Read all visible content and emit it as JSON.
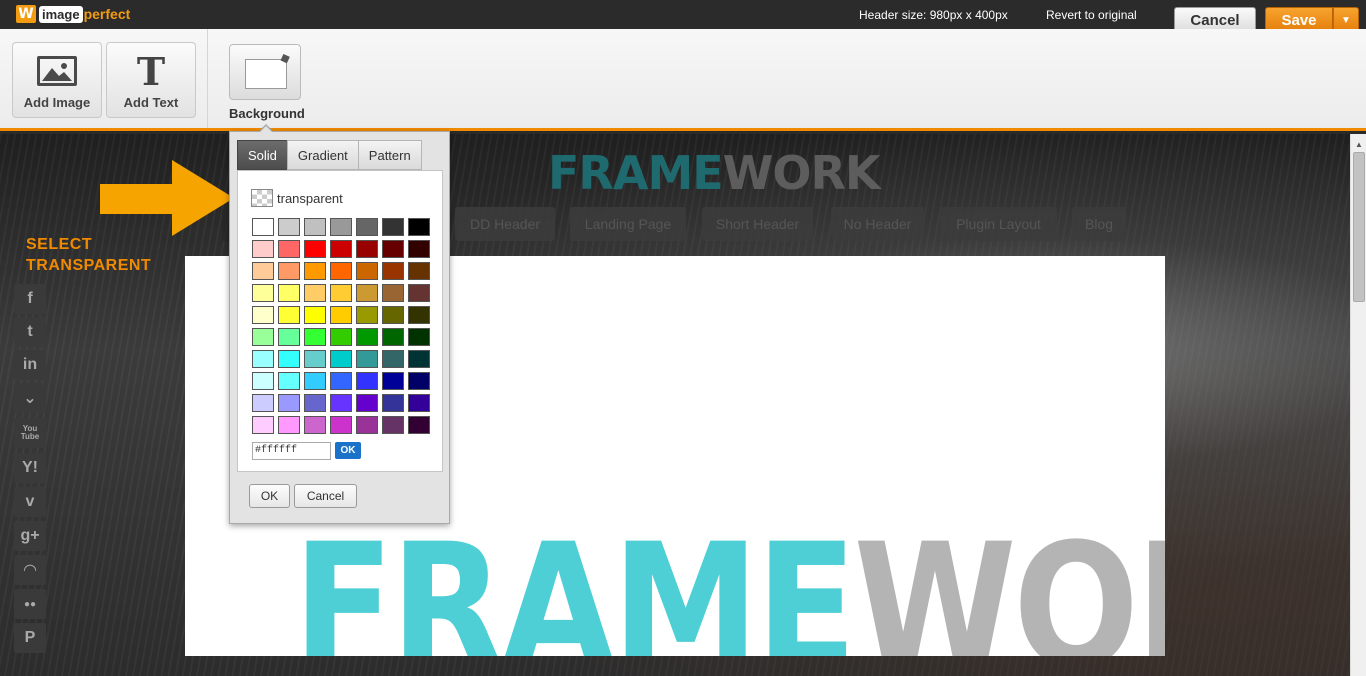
{
  "app": {
    "logo_mark": "W",
    "logo_image": "image",
    "logo_perfect": "perfect"
  },
  "topbar": {
    "header_size": "Header size: 980px x 400px",
    "revert": "Revert to original",
    "cancel": "Cancel",
    "save": "Save",
    "save_caret": "▼"
  },
  "toolbar": {
    "add_image": "Add Image",
    "add_text": "Add Text",
    "add_text_glyph": "T",
    "background": "Background"
  },
  "canvas": {
    "ghost_title_a": "FRAME",
    "ghost_title_b": "WORK",
    "nav": [
      "DD Header",
      "Landing Page",
      "Short Header",
      "No Header",
      "Plugin Layout",
      "Blog"
    ],
    "annotation_line1": "SELECT",
    "annotation_line2": "TRANSPARENT",
    "big_title_a": "FRAME",
    "big_title_b": "WORK",
    "social_icons": [
      "facebook-icon",
      "twitter-icon",
      "linkedin-icon",
      "delicious-icon",
      "youtube-icon",
      "yahoo-icon",
      "vimeo-icon",
      "google-plus-icon",
      "rss-icon",
      "flickr-icon",
      "pinterest-icon"
    ],
    "social_glyphs": [
      "f",
      "t",
      "in",
      "⌄",
      "You Tube",
      "Y!",
      "v",
      "g+",
      "◠",
      "●●",
      "P"
    ]
  },
  "popup": {
    "tabs": [
      "Solid",
      "Gradient",
      "Pattern"
    ],
    "active_tab": "Solid",
    "transparent_label": "transparent",
    "hex_value": "#ffffff",
    "hex_ok": "OK",
    "ok": "OK",
    "cancel": "Cancel",
    "colors": [
      "#ffffff",
      "#cccccc",
      "#c0c0c0",
      "#999999",
      "#666666",
      "#333333",
      "#000000",
      "#ffcccc",
      "#ff6666",
      "#ff0000",
      "#cc0000",
      "#990000",
      "#660000",
      "#330000",
      "#ffcc99",
      "#ff9966",
      "#ff9900",
      "#ff6600",
      "#cc6600",
      "#993300",
      "#663300",
      "#ffff99",
      "#ffff66",
      "#ffcc66",
      "#ffcc33",
      "#cc9933",
      "#996633",
      "#663333",
      "#ffffcc",
      "#ffff33",
      "#ffff00",
      "#ffcc00",
      "#999900",
      "#666600",
      "#333300",
      "#99ff99",
      "#66ff99",
      "#33ff33",
      "#33cc00",
      "#009900",
      "#006600",
      "#003300",
      "#99ffff",
      "#33ffff",
      "#66cccc",
      "#00cccc",
      "#339999",
      "#336666",
      "#003333",
      "#ccffff",
      "#66ffff",
      "#33ccff",
      "#3366ff",
      "#3333ff",
      "#000099",
      "#000066",
      "#ccccff",
      "#9999ff",
      "#6666cc",
      "#6633ff",
      "#6600cc",
      "#333399",
      "#330099",
      "#ffccff",
      "#ff99ff",
      "#cc66cc",
      "#cc33cc",
      "#993399",
      "#663366",
      "#330033"
    ]
  },
  "colors": {
    "accent": "#f08a00",
    "frame_teal": "#4dcfd5",
    "frame_gray": "#b4b4b4"
  }
}
